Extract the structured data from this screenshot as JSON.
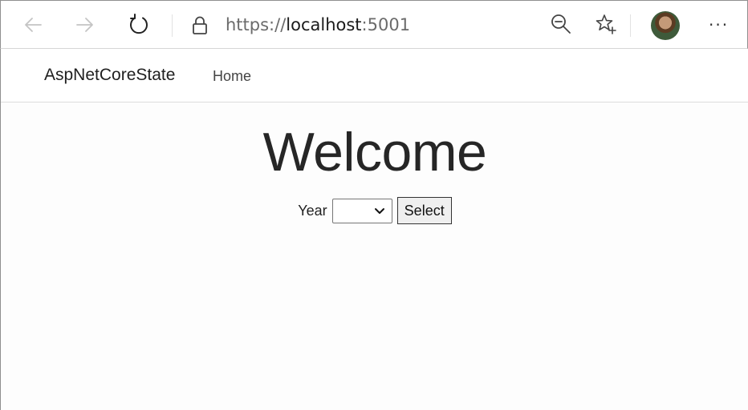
{
  "browser": {
    "url_scheme": "https://",
    "url_host": "localhost",
    "url_port": ":5001",
    "icons": [
      "back-arrow-icon",
      "forward-arrow-icon",
      "refresh-icon",
      "lock-icon",
      "zoom-out-icon",
      "add-favorite-icon",
      "profile-avatar",
      "more-icon"
    ]
  },
  "navbar": {
    "brand": "AspNetCoreState",
    "links": [
      {
        "label": "Home"
      }
    ]
  },
  "main": {
    "heading": "Welcome",
    "form": {
      "label": "Year",
      "select_value": "",
      "button_label": "Select"
    }
  }
}
